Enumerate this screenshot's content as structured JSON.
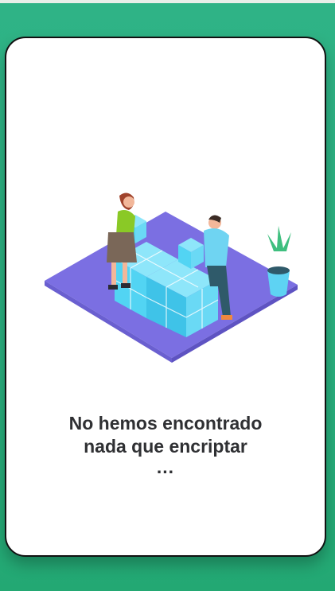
{
  "empty_state": {
    "message_line1": "No hemos encontrado",
    "message_line2": "nada que encriptar",
    "message_dots": "..."
  },
  "colors": {
    "background": "#2fb386",
    "card": "#ffffff",
    "platform": "#7b6fe2",
    "cube": "#52d4f3",
    "text": "#2f3033"
  },
  "illustration": {
    "icon": "people-stacking-cubes-illustration"
  }
}
